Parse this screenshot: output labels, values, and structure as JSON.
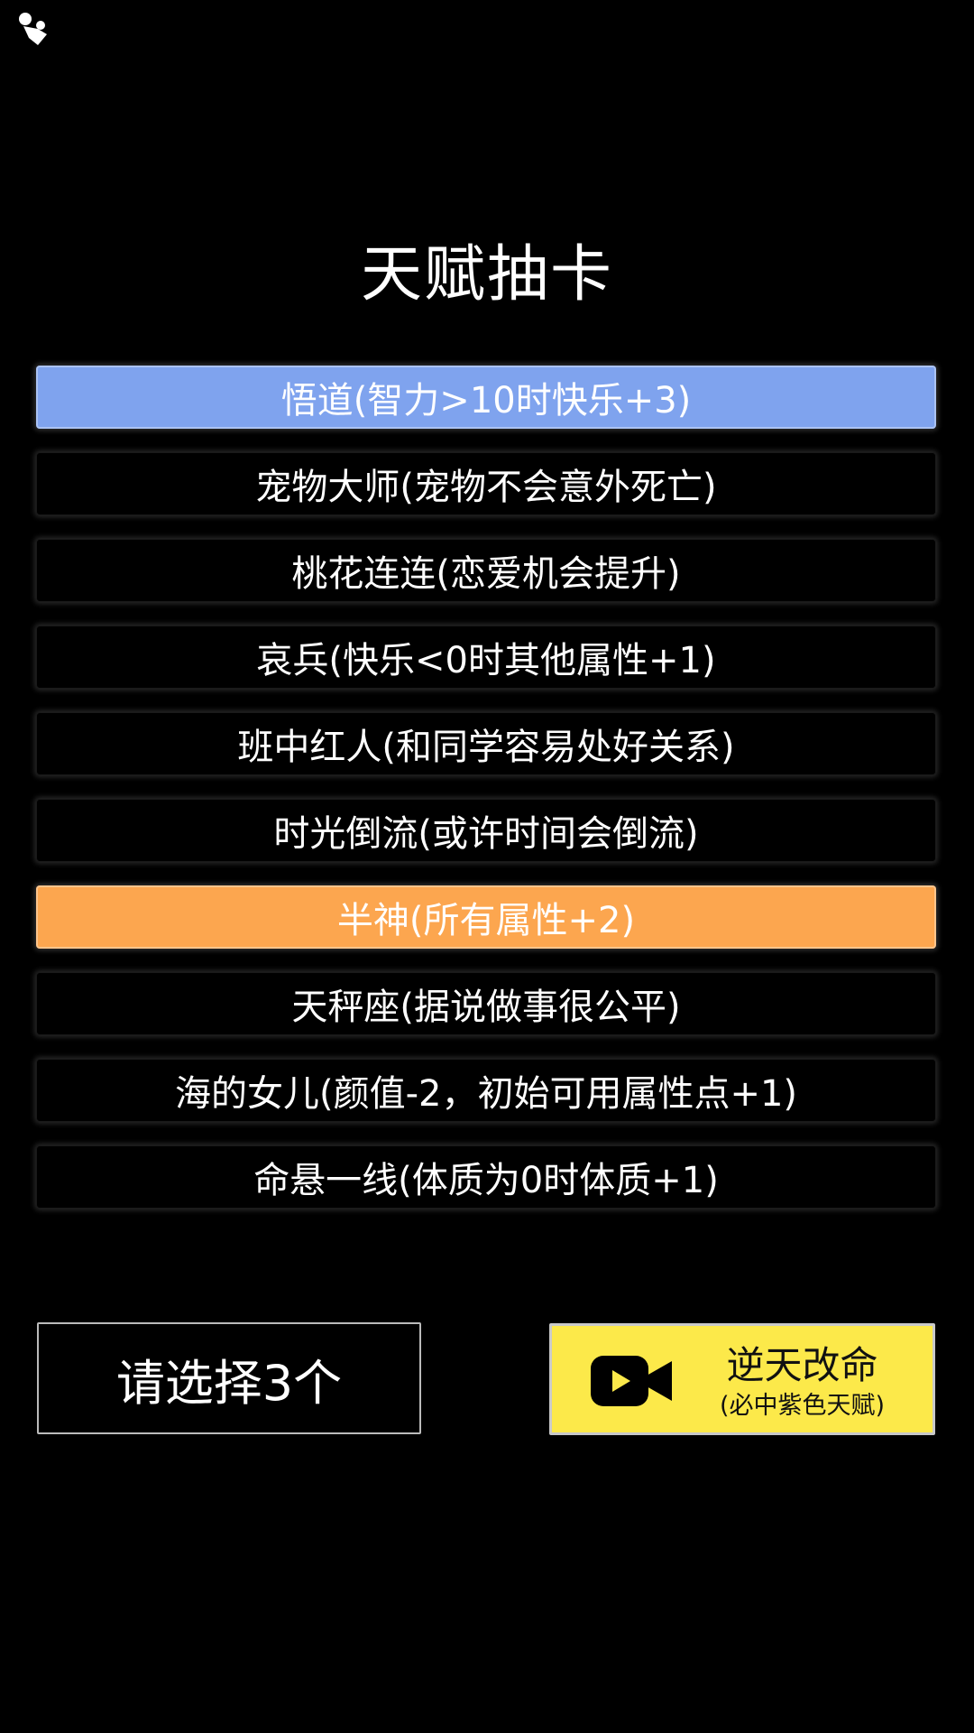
{
  "header": {
    "corner_icon": "puzzle-piece-icon",
    "title": "天赋抽卡"
  },
  "talents": [
    {
      "label": "悟道(智力>10时快乐+3)",
      "rarity": "blue",
      "color": "#7fa3ee"
    },
    {
      "label": "宠物大师(宠物不会意外死亡)",
      "rarity": "normal",
      "color": "#000000"
    },
    {
      "label": "桃花连连(恋爱机会提升)",
      "rarity": "normal",
      "color": "#000000"
    },
    {
      "label": "哀兵(快乐<0时其他属性+1)",
      "rarity": "normal",
      "color": "#000000"
    },
    {
      "label": "班中红人(和同学容易处好关系)",
      "rarity": "normal",
      "color": "#000000"
    },
    {
      "label": "时光倒流(或许时间会倒流)",
      "rarity": "normal",
      "color": "#000000"
    },
    {
      "label": "半神(所有属性+2)",
      "rarity": "orange",
      "color": "#fca64f"
    },
    {
      "label": "天秤座(据说做事很公平)",
      "rarity": "normal",
      "color": "#000000"
    },
    {
      "label": "海的女儿(颜值-2，初始可用属性点+1)",
      "rarity": "normal",
      "color": "#000000"
    },
    {
      "label": "命悬一线(体质为0时体质+1)",
      "rarity": "normal",
      "color": "#000000"
    }
  ],
  "footer": {
    "select_label": "请选择3个",
    "reroll_label": "逆天改命",
    "reroll_sublabel": "(必中紫色天赋)",
    "reroll_icon": "video-camera-icon",
    "reroll_color": "#fce94a"
  }
}
